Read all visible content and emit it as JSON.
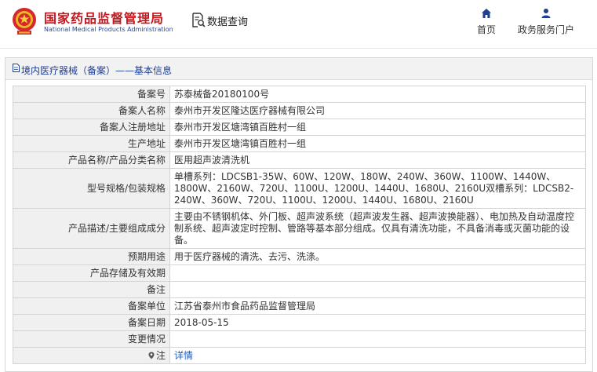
{
  "header": {
    "brand_cn": "国家药品监督管理局",
    "brand_en": "National Medical Products Administration",
    "query_label": "数据查询",
    "nav": [
      {
        "label": "首页",
        "icon": "home-icon"
      },
      {
        "label": "政务服务门户",
        "icon": "user-icon"
      }
    ]
  },
  "panel": {
    "title": "境内医疗器械（备案）——基本信息"
  },
  "rows": [
    {
      "label": "备案号",
      "value": "苏泰械备20180100号"
    },
    {
      "label": "备案人名称",
      "value": "泰州市开发区隆达医疗器械有限公司"
    },
    {
      "label": "备案人注册地址",
      "value": "泰州市开发区塘湾镇百胜村一组"
    },
    {
      "label": "生产地址",
      "value": "泰州市开发区塘湾镇百胜村一组"
    },
    {
      "label": "产品名称/产品分类名称",
      "value": "医用超声波清洗机"
    },
    {
      "label": "型号规格/包装规格",
      "value": "单槽系列：LDCSB1-35W、60W、120W、180W、240W、360W、1100W、1440W、1800W、2160W、720U、1100U、1200U、1440U、1680U、2160U双槽系列：LDCSB2-240W、360W、720U、1100U、1200U、1440U、1680U、2160U"
    },
    {
      "label": "产品描述/主要组成成分",
      "value": "主要由不锈钢机体、外门板、超声波系统（超声波发生器、超声波换能器）、电加热及自动温度控制系统、超声波定时控制、管路等基本部分组成。仅具有清洗功能，不具备消毒或灭菌功能的设备。"
    },
    {
      "label": "预期用途",
      "value": "用于医疗器械的清洗、去污、洗涤。"
    },
    {
      "label": "产品存储及有效期",
      "value": ""
    },
    {
      "label": "备注",
      "value": ""
    },
    {
      "label": "备案单位",
      "value": "江苏省泰州市食品药品监督管理局"
    },
    {
      "label": "备案日期",
      "value": "2018-05-15"
    },
    {
      "label": "变更情况",
      "value": ""
    },
    {
      "label": "注",
      "value": "详情"
    }
  ],
  "colors": {
    "brand_red": "#c4161c",
    "brand_blue": "#2b4aa0",
    "link_blue": "#1a5ec2",
    "label_bg": "#f0f0f0"
  }
}
